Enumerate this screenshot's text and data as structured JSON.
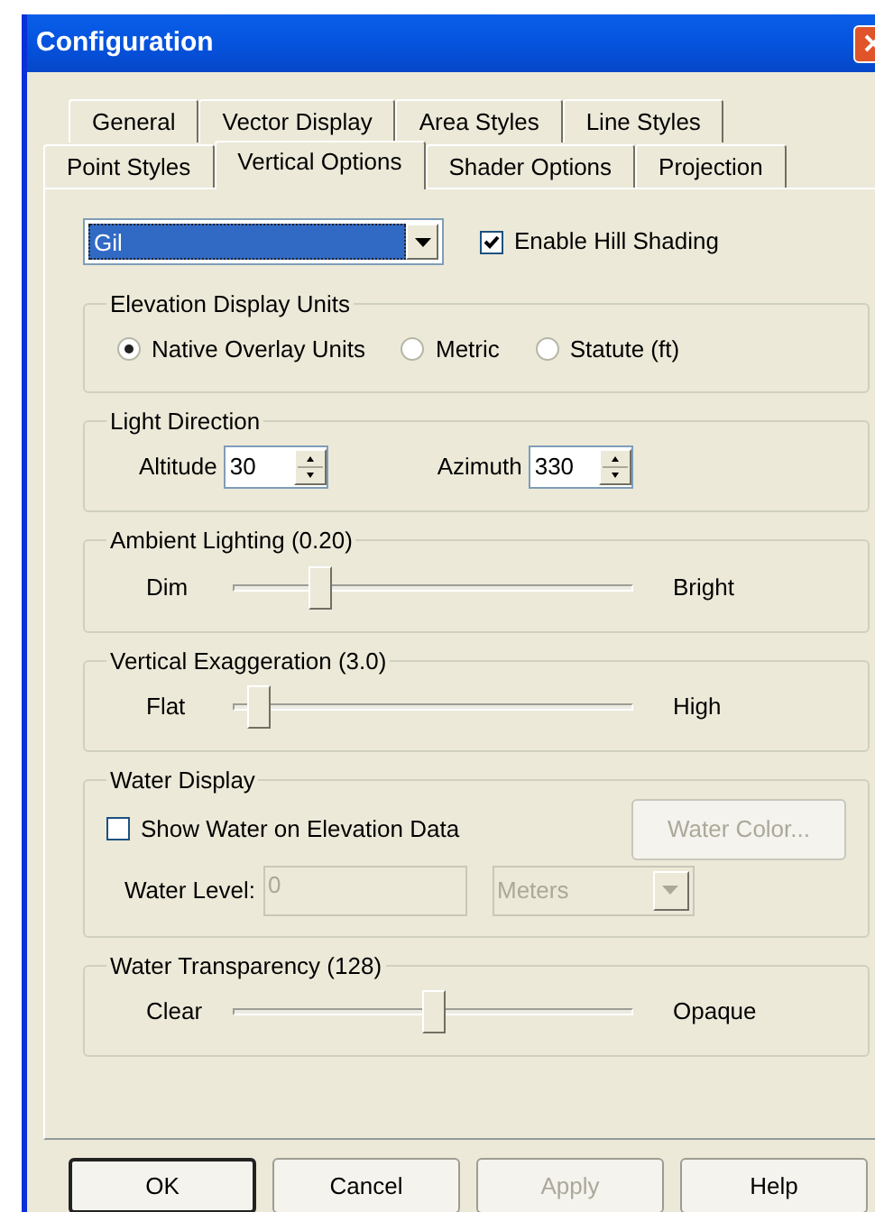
{
  "window": {
    "title": "Configuration"
  },
  "tab_rows": [
    [
      {
        "label": "General",
        "selected": false
      },
      {
        "label": "Vector Display",
        "selected": false
      },
      {
        "label": "Area Styles",
        "selected": false
      },
      {
        "label": "Line Styles",
        "selected": false
      }
    ],
    [
      {
        "label": "Point Styles",
        "selected": false
      },
      {
        "label": "Vertical Options",
        "selected": true
      },
      {
        "label": "Shader Options",
        "selected": false
      },
      {
        "label": "Projection",
        "selected": false
      }
    ]
  ],
  "shader_dropdown": {
    "value": "Gil"
  },
  "hill_shading": {
    "label": "Enable Hill Shading",
    "checked": true
  },
  "elevation_units": {
    "title": "Elevation Display Units",
    "options": [
      {
        "label": "Native Overlay Units",
        "selected": true
      },
      {
        "label": "Metric",
        "selected": false
      },
      {
        "label": "Statute (ft)",
        "selected": false
      }
    ]
  },
  "light_direction": {
    "title": "Light Direction",
    "fields": [
      {
        "label": "Altitude",
        "value": "30"
      },
      {
        "label": "Azimuth",
        "value": "330"
      }
    ]
  },
  "sliders": [
    {
      "title": "Ambient Lighting (0.20)",
      "min_label": "Dim",
      "max_label": "Bright",
      "level": 0.2
    },
    {
      "title": "Vertical Exaggeration (3.0)",
      "min_label": "Flat",
      "max_label": "High",
      "level": 0.04
    }
  ],
  "water_display": {
    "title": "Water Display",
    "show_water": {
      "label": "Show Water on Elevation Data",
      "checked": false
    },
    "color_button": {
      "label": "Water Color...",
      "disabled": true
    },
    "level_label": "Water Level:",
    "level_value": "0",
    "level_disabled": true,
    "units": {
      "value": "Meters",
      "disabled": true
    }
  },
  "transparency": {
    "title": "Water Transparency (128)",
    "min_label": "Clear",
    "max_label": "Opaque",
    "level": 0.5
  },
  "buttons": [
    {
      "label": "OK",
      "default": true,
      "disabled": false
    },
    {
      "label": "Cancel",
      "default": false,
      "disabled": false
    },
    {
      "label": "Apply",
      "default": false,
      "disabled": true
    },
    {
      "label": "Help",
      "default": false,
      "disabled": false
    }
  ]
}
